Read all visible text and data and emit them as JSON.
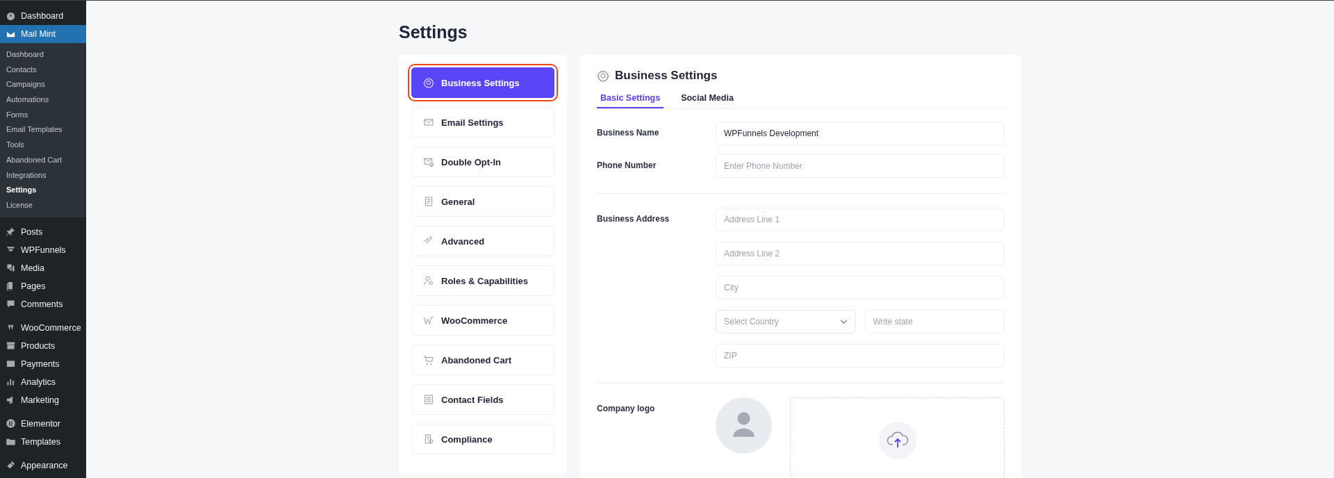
{
  "admin_menu": [
    [
      {
        "label": "Dashboard",
        "selected": false
      },
      {
        "label": "Mail Mint",
        "selected": true,
        "children": [
          {
            "label": "Dashboard",
            "selected": false
          },
          {
            "label": "Contacts",
            "selected": false
          },
          {
            "label": "Campaigns",
            "selected": false
          },
          {
            "label": "Automations",
            "selected": false
          },
          {
            "label": "Forms",
            "selected": false
          },
          {
            "label": "Email Templates",
            "selected": false
          },
          {
            "label": "Tools",
            "selected": false
          },
          {
            "label": "Abandoned Cart",
            "selected": false
          },
          {
            "label": "Integrations",
            "selected": false
          },
          {
            "label": "Settings",
            "selected": true
          },
          {
            "label": "License",
            "selected": false
          }
        ]
      }
    ],
    [
      {
        "label": "Posts",
        "selected": false
      },
      {
        "label": "WPFunnels",
        "selected": false
      },
      {
        "label": "Media",
        "selected": false
      },
      {
        "label": "Pages",
        "selected": false
      },
      {
        "label": "Comments",
        "selected": false
      }
    ],
    [
      {
        "label": "WooCommerce",
        "selected": false
      },
      {
        "label": "Products",
        "selected": false
      },
      {
        "label": "Payments",
        "selected": false
      },
      {
        "label": "Analytics",
        "selected": false
      },
      {
        "label": "Marketing",
        "selected": false
      }
    ],
    [
      {
        "label": "Elementor",
        "selected": false
      },
      {
        "label": "Templates",
        "selected": false
      }
    ],
    [
      {
        "label": "Appearance",
        "selected": false
      }
    ]
  ],
  "page_title": "Settings",
  "settings_nav": [
    {
      "label": "Business Settings",
      "selected": true
    },
    {
      "label": "Email Settings",
      "selected": false
    },
    {
      "label": "Double Opt-In",
      "selected": false
    },
    {
      "label": "General",
      "selected": false
    },
    {
      "label": "Advanced",
      "selected": false
    },
    {
      "label": "Roles & Capabilities",
      "selected": false
    },
    {
      "label": "WooCommerce",
      "selected": false
    },
    {
      "label": "Abandoned Cart",
      "selected": false
    },
    {
      "label": "Contact Fields",
      "selected": false
    },
    {
      "label": "Compliance",
      "selected": false
    }
  ],
  "panel": {
    "title": "Business Settings",
    "tabs": [
      {
        "label": "Basic Settings",
        "selected": true
      },
      {
        "label": "Social Media",
        "selected": false
      }
    ],
    "sections": [
      {
        "rows": [
          {
            "label": "Business Name",
            "fields": [
              [
                {
                  "kind": "input",
                  "value": "WPFunnels Development"
                }
              ]
            ]
          },
          {
            "label": "Phone Number",
            "fields": [
              [
                {
                  "kind": "input",
                  "placeholder": "Enter Phone Number"
                }
              ]
            ]
          }
        ]
      },
      {
        "rows": [
          {
            "label": "Business Address",
            "fields": [
              [
                {
                  "kind": "input",
                  "placeholder": "Address Line 1"
                }
              ],
              [
                {
                  "kind": "input",
                  "placeholder": "Address Line 2"
                }
              ],
              [
                {
                  "kind": "input",
                  "placeholder": "City"
                }
              ],
              [
                {
                  "kind": "select",
                  "placeholder": "Select Country"
                },
                {
                  "kind": "input",
                  "placeholder": "Write state"
                }
              ],
              [
                {
                  "kind": "input",
                  "placeholder": "ZIP"
                }
              ]
            ]
          }
        ]
      },
      {
        "rows": [
          {
            "label": "Company logo",
            "fields": [
              [
                {
                  "kind": "logo"
                }
              ]
            ]
          }
        ]
      }
    ]
  }
}
